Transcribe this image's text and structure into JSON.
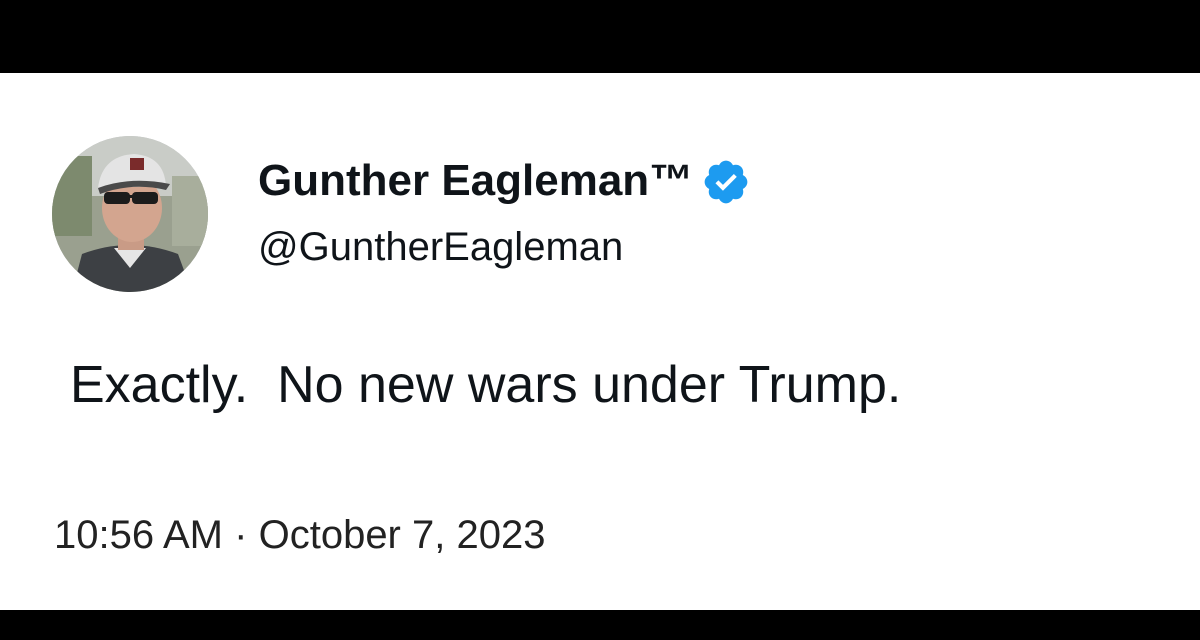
{
  "tweet": {
    "display_name": "Gunther Eagleman™",
    "handle": "@GuntherEagleman",
    "verified": true,
    "text": "Exactly.  No new wars under Trump.",
    "time": "10:56 AM",
    "separator": "·",
    "date": "October 7, 2023"
  },
  "icons": {
    "avatar": "profile-photo",
    "verified": "verified-badge-icon"
  },
  "colors": {
    "card_background": "#ffffff",
    "frame_background": "#000000",
    "text": "#0f1419",
    "verified_badge": "#1d9bf0"
  }
}
